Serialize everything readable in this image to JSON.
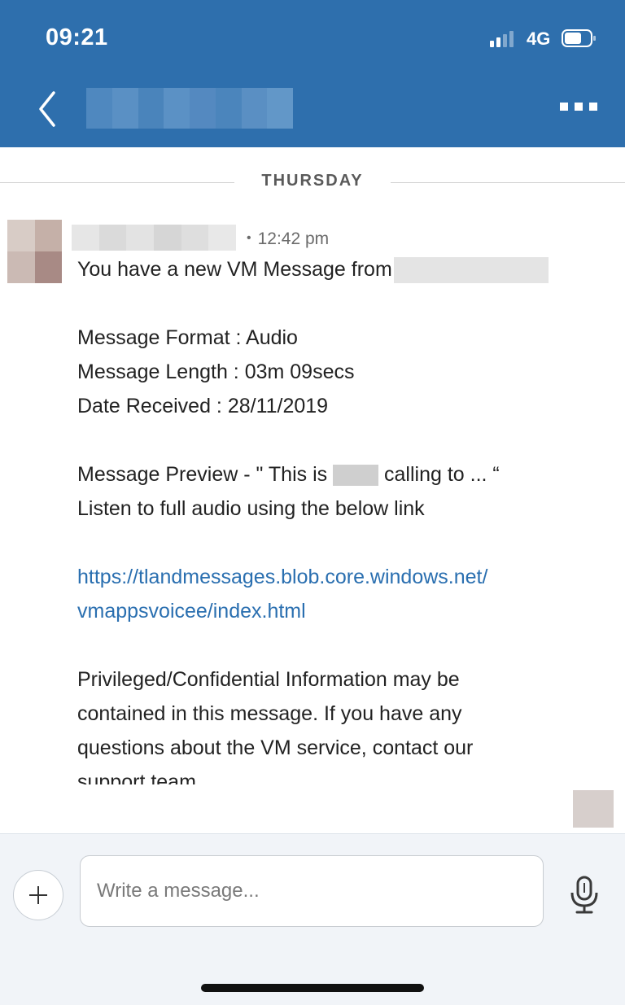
{
  "status_bar": {
    "time": "09:21",
    "network": "4G",
    "signal_bars_active": 2,
    "signal_bars_total": 4
  },
  "header": {
    "background_color": "#2e6fad",
    "title": "",
    "back_icon": "chevron-left-icon",
    "more_icon": "more-options-icon"
  },
  "conversation": {
    "day_separator": "THURSDAY",
    "message": {
      "sender_name": "",
      "time": "12:42 pm",
      "intro": "You have a new VM Message from",
      "format_line": "Message Format : Audio",
      "length_line": "Message Length : 03m 09secs",
      "date_line": "Date Received : 28/11/2019",
      "preview_start": "Message Preview - \" This is",
      "preview_end": "calling to ... “",
      "listen_line": "Listen to full audio using the below link",
      "link_line1": "https://tlandmessages.blob.core.windows.net/",
      "link_line2": "vmappsvoicee/index.html",
      "link_color": "#2a6fb0",
      "disclaimer_line1": "Privileged/Confidential Information may be",
      "disclaimer_line2": "contained in this message. If you have any",
      "disclaimer_line3": "questions about the VM service, contact our",
      "disclaimer_line4": "support team."
    }
  },
  "composer": {
    "placeholder": "Write a message...",
    "add_icon": "plus-icon",
    "mic_icon": "microphone-icon"
  }
}
